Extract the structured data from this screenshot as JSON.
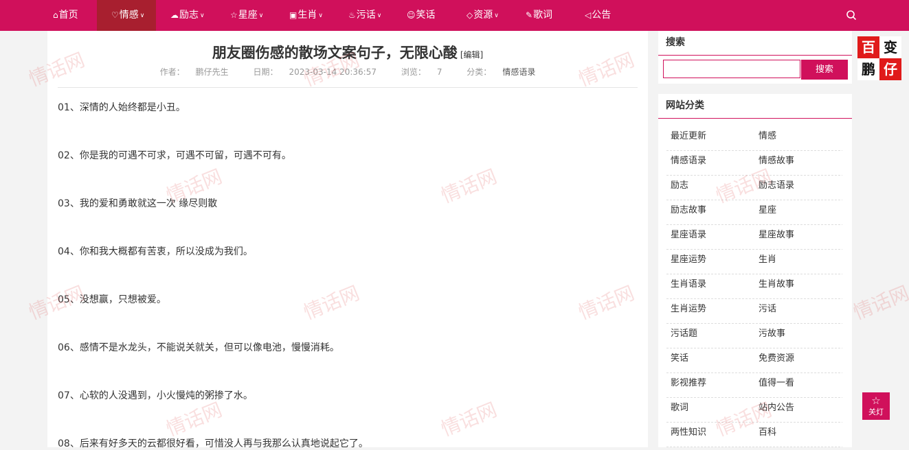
{
  "nav": {
    "items": [
      {
        "label": "首页",
        "icon": "home-icon",
        "dropdown": false,
        "active": false
      },
      {
        "label": "情感",
        "icon": "heart-chat-icon",
        "dropdown": true,
        "active": true
      },
      {
        "label": "励志",
        "icon": "cloud-icon",
        "dropdown": true,
        "active": false
      },
      {
        "label": "星座",
        "icon": "star-icon",
        "dropdown": true,
        "active": false
      },
      {
        "label": "生肖",
        "icon": "calendar-icon",
        "dropdown": true,
        "active": false
      },
      {
        "label": "污话",
        "icon": "flame-icon",
        "dropdown": true,
        "active": false
      },
      {
        "label": "笑话",
        "icon": "smile-icon",
        "dropdown": false,
        "active": false
      },
      {
        "label": "资源",
        "icon": "diamond-icon",
        "dropdown": true,
        "active": false
      },
      {
        "label": "歌词",
        "icon": "pen-icon",
        "dropdown": false,
        "active": false
      },
      {
        "label": "公告",
        "icon": "megaphone-icon",
        "dropdown": false,
        "active": false
      }
    ],
    "search_icon": "search-icon"
  },
  "article": {
    "title": "朋友圈伤感的散场文案句子，无限心酸",
    "edit_label": "[编辑]",
    "meta": {
      "author_label": "作者：",
      "author": "鹏仔先生",
      "date_label": "日期：",
      "date": "2023-03-14 20:36:57",
      "views_label": "浏览：",
      "views": "7",
      "category_label": "分类：",
      "category": "情感语录"
    },
    "paragraphs": [
      "01、深情的人始终都是小丑。",
      "02、你是我的可遇不可求，可遇不可留，可遇不可有。",
      "03、我的爱和勇敢就这一次 缘尽则散",
      "04、你和我大概都有苦衷，所以没成为我们。",
      "05、没想赢，只想被爱。",
      "06、感情不是水龙头，不能说关就关，但可以像电池，慢慢消耗。",
      "07、心软的人没遇到，小火慢炖的粥掺了水。",
      "08、后来有好多天的云都很好看，可惜没人再与我那么认真地说起它了。"
    ]
  },
  "sidebar": {
    "search": {
      "heading": "搜索",
      "placeholder": "",
      "button_label": "搜索"
    },
    "categories": {
      "heading": "网站分类",
      "items": [
        "最近更新",
        "情感",
        "情感语录",
        "情感故事",
        "励志",
        "励志语录",
        "励志故事",
        "星座",
        "星座语录",
        "星座故事",
        "星座运势",
        "生肖",
        "生肖语录",
        "生肖故事",
        "生肖运势",
        "污话",
        "污话题",
        "污故事",
        "笑话",
        "免费资源",
        "影视推荐",
        "值得一看",
        "歌词",
        "站内公告",
        "两性知识",
        "百科"
      ]
    }
  },
  "logo": {
    "chars": [
      "百",
      "变",
      "鹏",
      "仔"
    ],
    "colors": {
      "red": "#e01a1a",
      "white": "#ffffff",
      "black": "#111111"
    }
  },
  "lamp": {
    "label": "关灯",
    "icon": "star-outline-icon"
  },
  "watermark_text": "情话网",
  "colors": {
    "brand": "#d0105b",
    "active_nav": "#a81f2f"
  }
}
